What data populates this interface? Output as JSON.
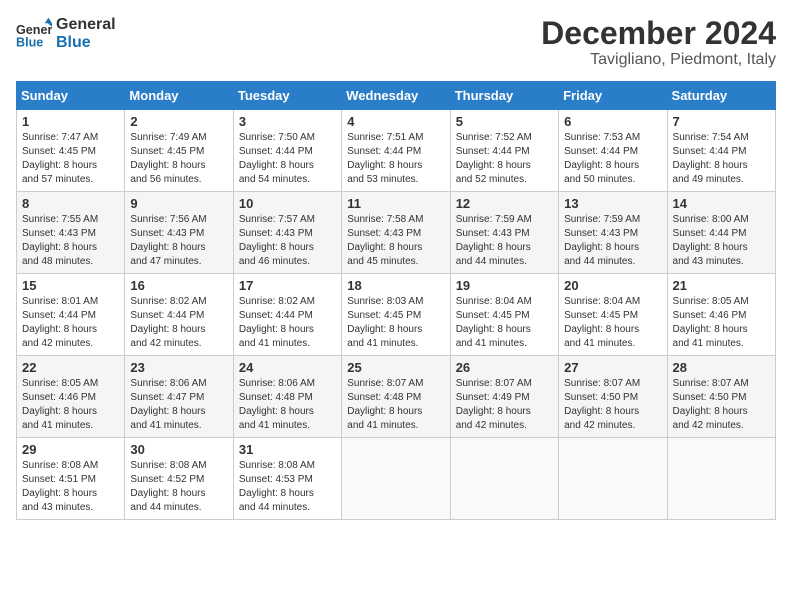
{
  "header": {
    "logo_line1": "General",
    "logo_line2": "Blue",
    "month": "December 2024",
    "location": "Tavigliano, Piedmont, Italy"
  },
  "weekdays": [
    "Sunday",
    "Monday",
    "Tuesday",
    "Wednesday",
    "Thursday",
    "Friday",
    "Saturday"
  ],
  "weeks": [
    [
      {
        "day": "1",
        "sunrise": "7:47 AM",
        "sunset": "4:45 PM",
        "daylight": "8 hours and 57 minutes."
      },
      {
        "day": "2",
        "sunrise": "7:49 AM",
        "sunset": "4:45 PM",
        "daylight": "8 hours and 56 minutes."
      },
      {
        "day": "3",
        "sunrise": "7:50 AM",
        "sunset": "4:44 PM",
        "daylight": "8 hours and 54 minutes."
      },
      {
        "day": "4",
        "sunrise": "7:51 AM",
        "sunset": "4:44 PM",
        "daylight": "8 hours and 53 minutes."
      },
      {
        "day": "5",
        "sunrise": "7:52 AM",
        "sunset": "4:44 PM",
        "daylight": "8 hours and 52 minutes."
      },
      {
        "day": "6",
        "sunrise": "7:53 AM",
        "sunset": "4:44 PM",
        "daylight": "8 hours and 50 minutes."
      },
      {
        "day": "7",
        "sunrise": "7:54 AM",
        "sunset": "4:44 PM",
        "daylight": "8 hours and 49 minutes."
      }
    ],
    [
      {
        "day": "8",
        "sunrise": "7:55 AM",
        "sunset": "4:43 PM",
        "daylight": "8 hours and 48 minutes."
      },
      {
        "day": "9",
        "sunrise": "7:56 AM",
        "sunset": "4:43 PM",
        "daylight": "8 hours and 47 minutes."
      },
      {
        "day": "10",
        "sunrise": "7:57 AM",
        "sunset": "4:43 PM",
        "daylight": "8 hours and 46 minutes."
      },
      {
        "day": "11",
        "sunrise": "7:58 AM",
        "sunset": "4:43 PM",
        "daylight": "8 hours and 45 minutes."
      },
      {
        "day": "12",
        "sunrise": "7:59 AM",
        "sunset": "4:43 PM",
        "daylight": "8 hours and 44 minutes."
      },
      {
        "day": "13",
        "sunrise": "7:59 AM",
        "sunset": "4:43 PM",
        "daylight": "8 hours and 44 minutes."
      },
      {
        "day": "14",
        "sunrise": "8:00 AM",
        "sunset": "4:44 PM",
        "daylight": "8 hours and 43 minutes."
      }
    ],
    [
      {
        "day": "15",
        "sunrise": "8:01 AM",
        "sunset": "4:44 PM",
        "daylight": "8 hours and 42 minutes."
      },
      {
        "day": "16",
        "sunrise": "8:02 AM",
        "sunset": "4:44 PM",
        "daylight": "8 hours and 42 minutes."
      },
      {
        "day": "17",
        "sunrise": "8:02 AM",
        "sunset": "4:44 PM",
        "daylight": "8 hours and 41 minutes."
      },
      {
        "day": "18",
        "sunrise": "8:03 AM",
        "sunset": "4:45 PM",
        "daylight": "8 hours and 41 minutes."
      },
      {
        "day": "19",
        "sunrise": "8:04 AM",
        "sunset": "4:45 PM",
        "daylight": "8 hours and 41 minutes."
      },
      {
        "day": "20",
        "sunrise": "8:04 AM",
        "sunset": "4:45 PM",
        "daylight": "8 hours and 41 minutes."
      },
      {
        "day": "21",
        "sunrise": "8:05 AM",
        "sunset": "4:46 PM",
        "daylight": "8 hours and 41 minutes."
      }
    ],
    [
      {
        "day": "22",
        "sunrise": "8:05 AM",
        "sunset": "4:46 PM",
        "daylight": "8 hours and 41 minutes."
      },
      {
        "day": "23",
        "sunrise": "8:06 AM",
        "sunset": "4:47 PM",
        "daylight": "8 hours and 41 minutes."
      },
      {
        "day": "24",
        "sunrise": "8:06 AM",
        "sunset": "4:48 PM",
        "daylight": "8 hours and 41 minutes."
      },
      {
        "day": "25",
        "sunrise": "8:07 AM",
        "sunset": "4:48 PM",
        "daylight": "8 hours and 41 minutes."
      },
      {
        "day": "26",
        "sunrise": "8:07 AM",
        "sunset": "4:49 PM",
        "daylight": "8 hours and 42 minutes."
      },
      {
        "day": "27",
        "sunrise": "8:07 AM",
        "sunset": "4:50 PM",
        "daylight": "8 hours and 42 minutes."
      },
      {
        "day": "28",
        "sunrise": "8:07 AM",
        "sunset": "4:50 PM",
        "daylight": "8 hours and 42 minutes."
      }
    ],
    [
      {
        "day": "29",
        "sunrise": "8:08 AM",
        "sunset": "4:51 PM",
        "daylight": "8 hours and 43 minutes."
      },
      {
        "day": "30",
        "sunrise": "8:08 AM",
        "sunset": "4:52 PM",
        "daylight": "8 hours and 44 minutes."
      },
      {
        "day": "31",
        "sunrise": "8:08 AM",
        "sunset": "4:53 PM",
        "daylight": "8 hours and 44 minutes."
      },
      null,
      null,
      null,
      null
    ]
  ]
}
